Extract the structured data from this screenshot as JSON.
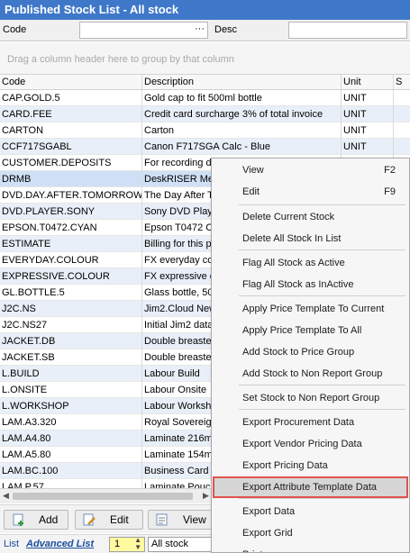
{
  "window": {
    "title": "Published Stock List - All stock"
  },
  "filter": {
    "code_label": "Code",
    "desc_label": "Desc",
    "ellipsis": "···"
  },
  "group_hint": "Drag a column header here to group by that column",
  "columns": [
    "Code",
    "Description",
    "Unit",
    "S"
  ],
  "rows": [
    {
      "code": "CAP.GOLD.5",
      "desc": "Gold cap to fit 500ml bottle",
      "unit": "UNIT"
    },
    {
      "code": "CARD.FEE",
      "desc": "Credit card surcharge 3% of total invoice",
      "unit": "UNIT"
    },
    {
      "code": "CARTON",
      "desc": "Carton",
      "unit": "UNIT"
    },
    {
      "code": "CCF717SGABL",
      "desc": "Canon F717SGA Calc - Blue",
      "unit": "UNIT"
    },
    {
      "code": "CUSTOMER.DEPOSITS",
      "desc": "For recording d",
      "unit": ""
    },
    {
      "code": "DRMB",
      "desc": "DeskRISER Mec",
      "unit": ""
    },
    {
      "code": "DVD.DAY.AFTER.TOMORROW",
      "desc": "The Day After T",
      "unit": ""
    },
    {
      "code": "DVD.PLAYER.SONY",
      "desc": "Sony DVD Player",
      "unit": ""
    },
    {
      "code": "EPSON.T0472.CYAN",
      "desc": "Epson T0472 C",
      "unit": ""
    },
    {
      "code": "ESTIMATE",
      "desc": "Billing for this p",
      "unit": ""
    },
    {
      "code": "EVERYDAY.COLOUR",
      "desc": "FX everyday co",
      "unit": ""
    },
    {
      "code": "EXPRESSIVE.COLOUR",
      "desc": "FX expressive c",
      "unit": ""
    },
    {
      "code": "GL.BOTTLE.5",
      "desc": "Glass bottle, 50",
      "unit": ""
    },
    {
      "code": "J2C.NS",
      "desc": "Jim2.Cloud New",
      "unit": ""
    },
    {
      "code": "J2C.NS27",
      "desc": "Initial Jim2 data",
      "unit": ""
    },
    {
      "code": "JACKET.DB",
      "desc": "Double breaste",
      "unit": ""
    },
    {
      "code": "JACKET.SB",
      "desc": "Double breaste",
      "unit": ""
    },
    {
      "code": "L.BUILD",
      "desc": "Labour Build",
      "unit": ""
    },
    {
      "code": "L.ONSITE",
      "desc": "Labour Onsite",
      "unit": ""
    },
    {
      "code": "L.WORKSHOP",
      "desc": "Labour Worksho",
      "unit": ""
    },
    {
      "code": "LAM.A3.320",
      "desc": "Royal Sovereig",
      "unit": ""
    },
    {
      "code": "LAM.A4.80",
      "desc": "Laminate 216m",
      "unit": ""
    },
    {
      "code": "LAM.A5.80",
      "desc": "Laminate 154m",
      "unit": ""
    },
    {
      "code": "LAM.BC.100",
      "desc": "Business Card L",
      "unit": ""
    },
    {
      "code": "LAM.P.57",
      "desc": "Laminate Pouch",
      "unit": ""
    }
  ],
  "toolbar": {
    "add": "Add",
    "edit": "Edit",
    "view": "View"
  },
  "status": {
    "list": "List",
    "advanced": "Advanced List",
    "page": "1",
    "view_value": "All stock"
  },
  "context_menu": {
    "items": [
      {
        "label": "View",
        "shortcut": "F2"
      },
      {
        "label": "Edit",
        "shortcut": "F9"
      },
      {
        "label": "Delete Current Stock",
        "shortcut": ""
      },
      {
        "label": "Delete All Stock In List",
        "shortcut": ""
      },
      {
        "label": "Flag All Stock as Active",
        "shortcut": ""
      },
      {
        "label": "Flag All Stock as InActive",
        "shortcut": ""
      },
      {
        "label": "Apply Price Template To Current",
        "shortcut": ""
      },
      {
        "label": "Apply Price Template To All",
        "shortcut": ""
      },
      {
        "label": "Add Stock to Price Group",
        "shortcut": ""
      },
      {
        "label": "Add Stock to Non Report Group",
        "shortcut": ""
      },
      {
        "label": "Set Stock to Non Report Group",
        "shortcut": ""
      },
      {
        "label": "Export Procurement Data",
        "shortcut": ""
      },
      {
        "label": "Export Vendor Pricing Data",
        "shortcut": ""
      },
      {
        "label": "Export Pricing Data",
        "shortcut": ""
      },
      {
        "label": "Export Attribute Template Data",
        "shortcut": ""
      },
      {
        "label": "Export Data",
        "shortcut": ""
      },
      {
        "label": "Export Grid",
        "shortcut": ""
      },
      {
        "label": "Print",
        "shortcut": ""
      }
    ]
  },
  "colors": {
    "title_bg": "#3f78c8",
    "row_alt": "#e9eff8",
    "row_selected": "#cfe0f6",
    "highlight_border": "#e0534f",
    "link": "#1b4fa0",
    "page_field": "#fff9a0"
  }
}
